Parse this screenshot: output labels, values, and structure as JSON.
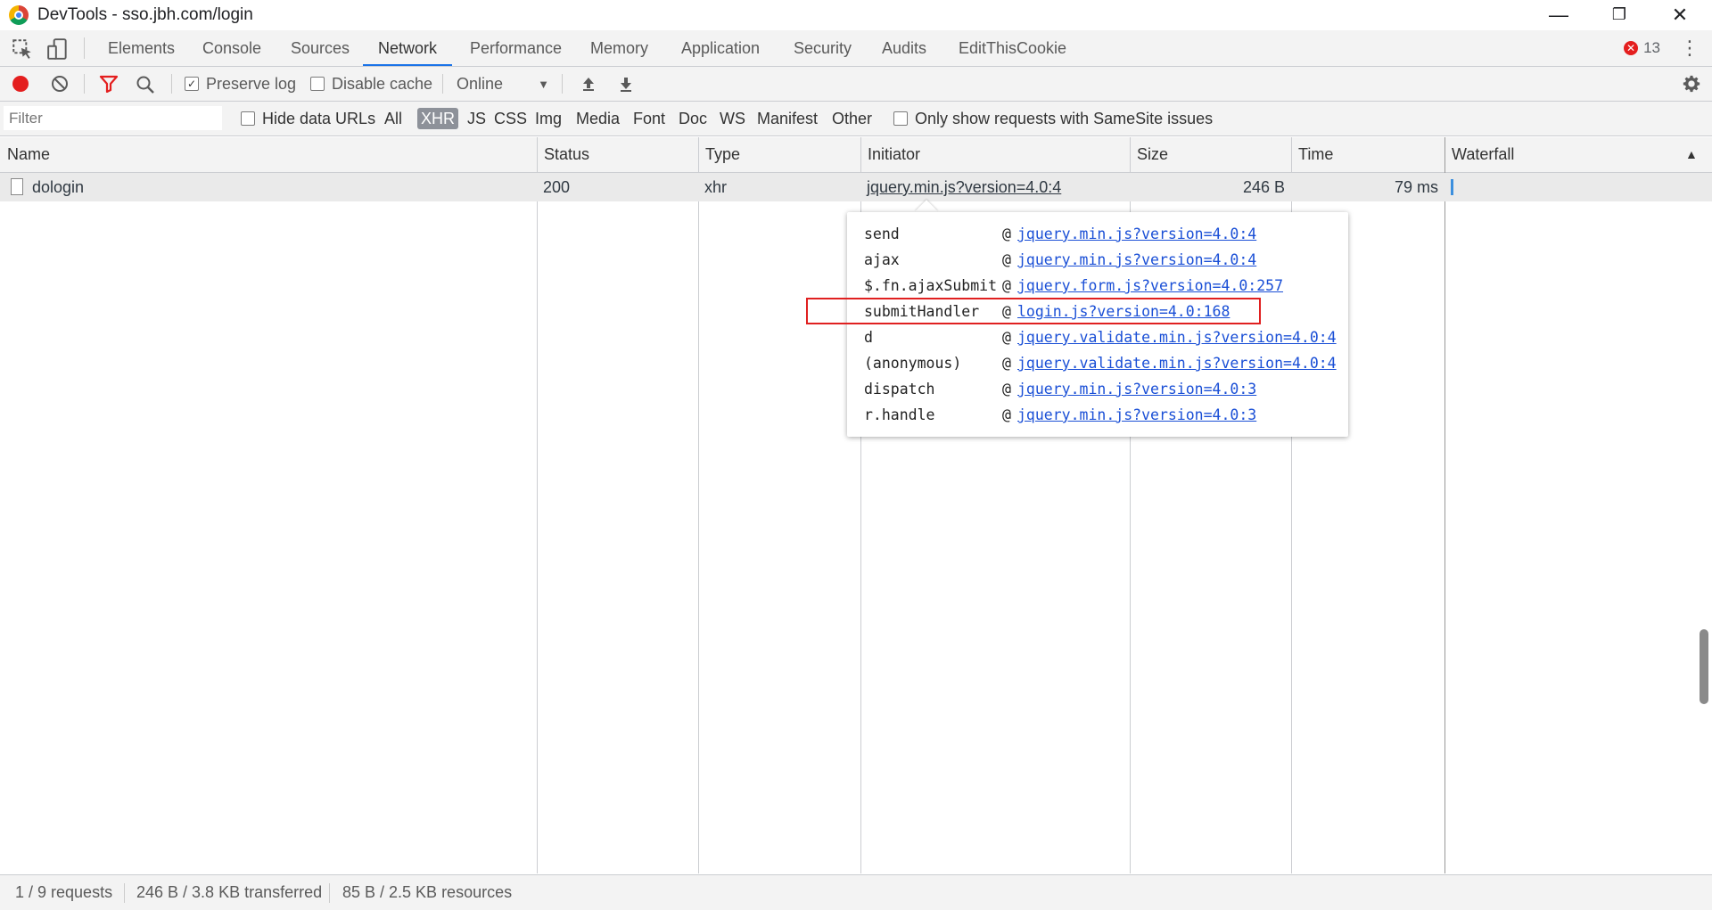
{
  "window": {
    "title": "DevTools - sso.jbh.com/login",
    "minimize_glyph": "—",
    "restore_glyph": "❐",
    "close_glyph": "✕"
  },
  "tabs": [
    {
      "label": "Elements"
    },
    {
      "label": "Console"
    },
    {
      "label": "Sources"
    },
    {
      "label": "Network",
      "active": true
    },
    {
      "label": "Performance"
    },
    {
      "label": "Memory"
    },
    {
      "label": "Application"
    },
    {
      "label": "Security"
    },
    {
      "label": "Audits"
    },
    {
      "label": "EditThisCookie"
    }
  ],
  "errors": {
    "count": "13",
    "icon_glyph": "✕"
  },
  "toolbar": {
    "preserve_log": {
      "label": "Preserve log",
      "checked": true
    },
    "disable_cache": {
      "label": "Disable cache",
      "checked": false
    },
    "throttling": "Online"
  },
  "filterbar": {
    "placeholder": "Filter",
    "hide_data_urls": "Hide data URLs",
    "types": [
      "All",
      "XHR",
      "JS",
      "CSS",
      "Img",
      "Media",
      "Font",
      "Doc",
      "WS",
      "Manifest",
      "Other"
    ],
    "active_type": "XHR",
    "samesite_label": "Only show requests with SameSite issues"
  },
  "table": {
    "columns": [
      "Name",
      "Status",
      "Type",
      "Initiator",
      "Size",
      "Time",
      "Waterfall"
    ],
    "rows": [
      {
        "name": "dologin",
        "status": "200",
        "type": "xhr",
        "initiator": "jquery.min.js?version=4.0:4",
        "size": "246 B",
        "time": "79 ms"
      }
    ]
  },
  "initiator_stack": [
    {
      "fn": "send",
      "at": "@",
      "link": "jquery.min.js?version=4.0:4"
    },
    {
      "fn": "ajax",
      "at": "@",
      "link": "jquery.min.js?version=4.0:4"
    },
    {
      "fn": "$.fn.ajaxSubmit",
      "at": "@",
      "link": "jquery.form.js?version=4.0:257"
    },
    {
      "fn": "submitHandler",
      "at": "@",
      "link": "login.js?version=4.0:168"
    },
    {
      "fn": "d",
      "at": "@",
      "link": "jquery.validate.min.js?version=4.0:4"
    },
    {
      "fn": "(anonymous)",
      "at": "@",
      "link": "jquery.validate.min.js?version=4.0:4"
    },
    {
      "fn": "dispatch",
      "at": "@",
      "link": "jquery.min.js?version=4.0:3"
    },
    {
      "fn": "r.handle",
      "at": "@",
      "link": "jquery.min.js?version=4.0:3"
    }
  ],
  "statusbar": {
    "requests": "1 / 9 requests",
    "transferred": "246 B / 3.8 KB transferred",
    "resources": "85 B / 2.5 KB resources"
  },
  "colors": {
    "accent": "#1a73e8",
    "record": "#e41e1e",
    "link": "#1a4fd6",
    "highlight": "#e02020"
  },
  "icons": {
    "sort": "▲",
    "dropdown": "▼",
    "kebab": "⋮",
    "checkmark": "✓"
  }
}
